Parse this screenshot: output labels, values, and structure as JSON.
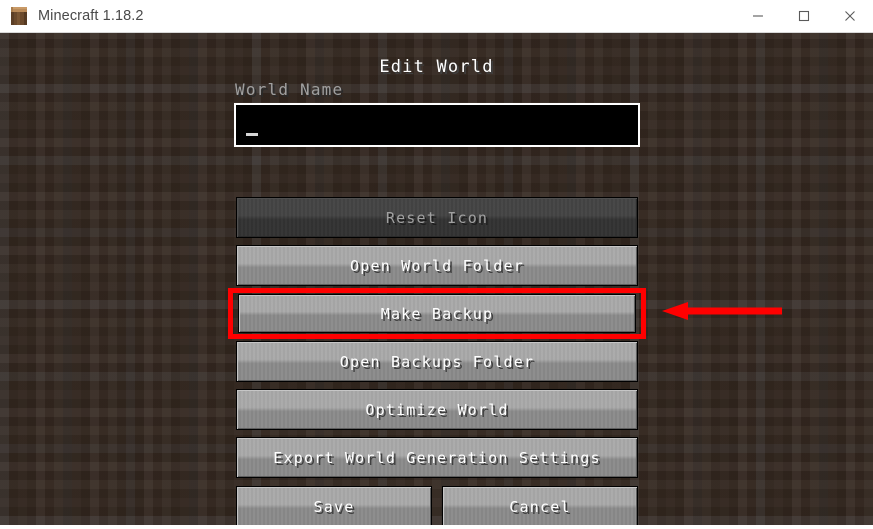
{
  "window": {
    "title": "Minecraft 1.18.2",
    "icon": "minecraft-block-icon",
    "controls": {
      "minimize": "minimize-icon",
      "maximize": "maximize-icon",
      "close": "close-icon"
    }
  },
  "screen": {
    "title": "Edit World",
    "world_name": {
      "label": "World Name",
      "value": "",
      "cursor": "_"
    },
    "buttons": [
      {
        "id": "reset-icon",
        "label": "Reset Icon",
        "enabled": false
      },
      {
        "id": "open-world",
        "label": "Open World Folder",
        "enabled": true
      },
      {
        "id": "make-backup",
        "label": "Make Backup",
        "enabled": true
      },
      {
        "id": "open-backups",
        "label": "Open Backups Folder",
        "enabled": true
      },
      {
        "id": "optimize-world",
        "label": "Optimize World",
        "enabled": true
      },
      {
        "id": "export-settings",
        "label": "Export World Generation Settings",
        "enabled": true
      },
      {
        "id": "save",
        "label": "Save",
        "enabled": true
      },
      {
        "id": "cancel",
        "label": "Cancel",
        "enabled": true
      }
    ]
  },
  "annotations": {
    "highlight_target": "Make Backup",
    "box_color": "#ff0000",
    "arrow_color": "#ff0000",
    "arrow_direction": "left"
  },
  "colors": {
    "background_dirt": "#33271f",
    "button_face": "#9a9a9a",
    "button_disabled": "#3a3a3a",
    "text_primary": "#ffffff",
    "text_muted": "#a0a0a0",
    "titlebar_bg": "#ffffff",
    "titlebar_text": "#4a4a4a",
    "field_bg": "#000000",
    "field_border": "#ffffff"
  }
}
